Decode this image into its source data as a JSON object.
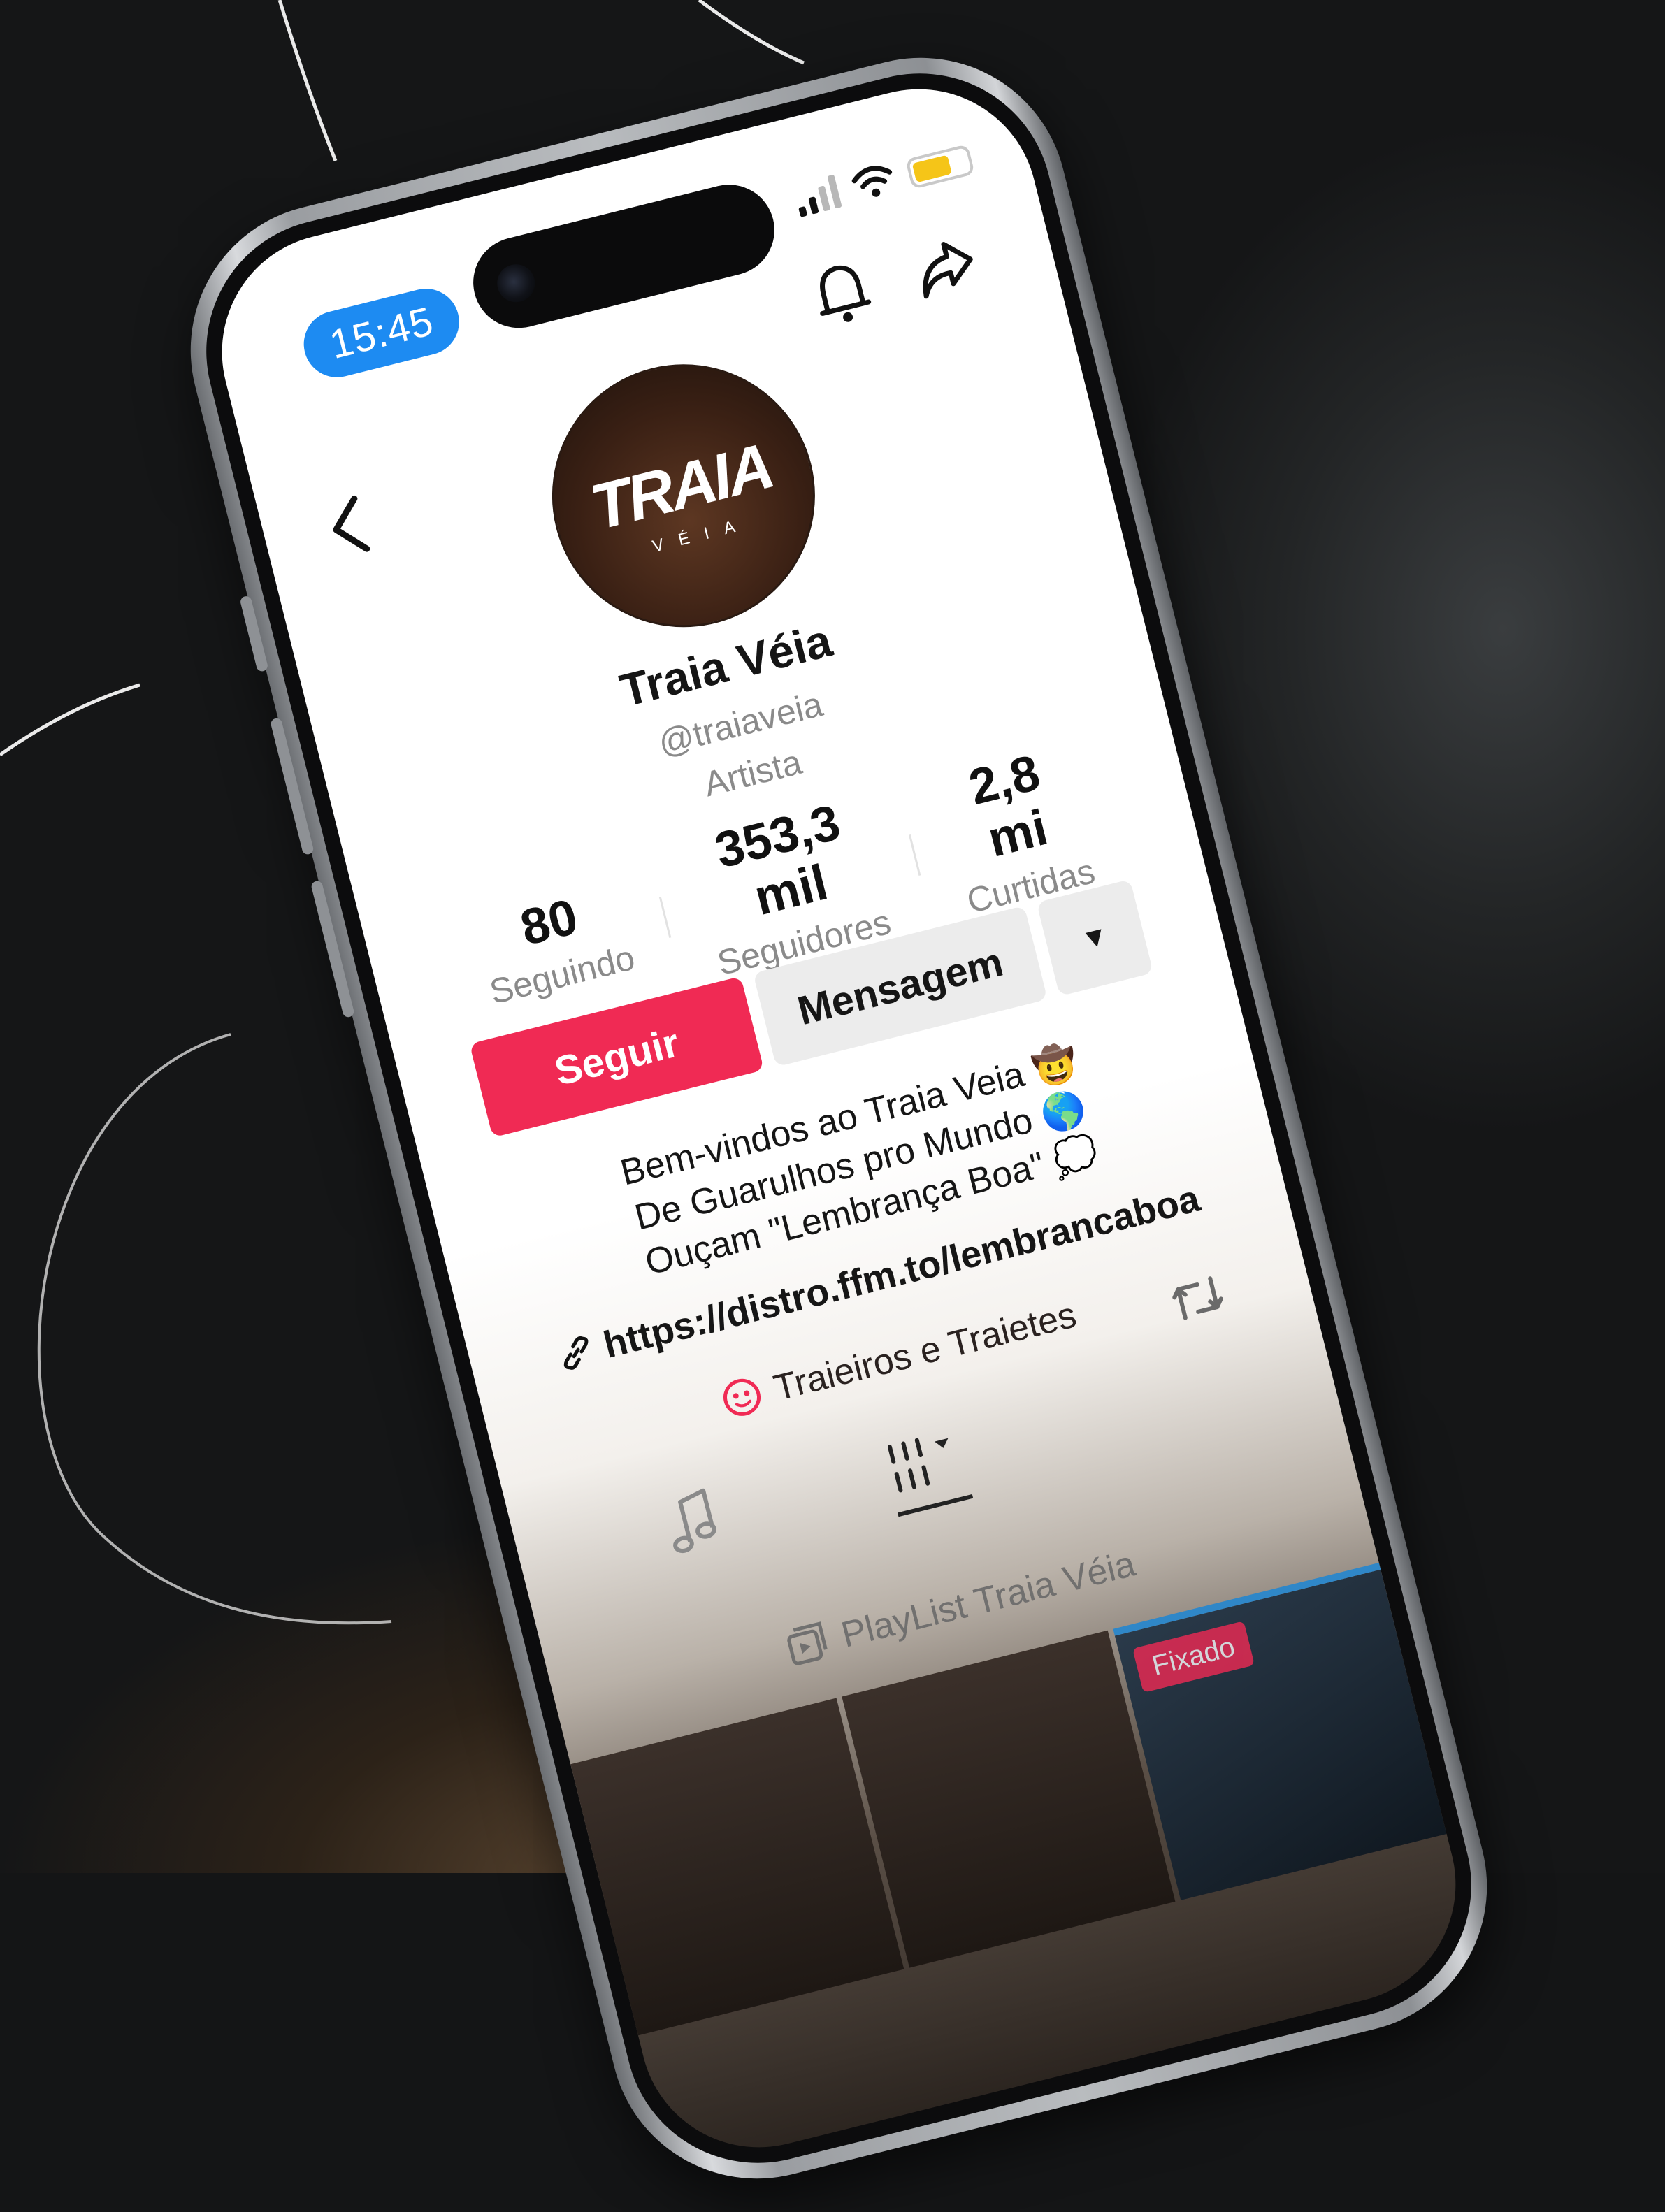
{
  "status_bar": {
    "time": "15:45"
  },
  "profile": {
    "display_name": "Traia Véia",
    "handle": "@traiaveia",
    "category": "Artista",
    "avatar_logo": "TRAIA",
    "avatar_logo_sub": "VÉIA"
  },
  "stats": [
    {
      "value": "80",
      "label": "Seguindo"
    },
    {
      "value": "353,3 mil",
      "label": "Seguidores"
    },
    {
      "value": "2,8 mi",
      "label": "Curtidas"
    }
  ],
  "actions": {
    "follow_label": "Seguir",
    "message_label": "Mensagem",
    "more_label": "▼"
  },
  "bio": {
    "lines": [
      "Bem-vindos ao Traia Veia 🤠",
      "De Guarulhos pro Mundo 🌎",
      "Ouçam \"Lembrança Boa\" 💭"
    ],
    "link": "https://distro.ffm.to/lembrancaboa",
    "community": "Traieiros e Traietes"
  },
  "tabs": {
    "playlist_label": "PlayList Traia Véia"
  },
  "grid": {
    "pinned_label": "Fixado"
  },
  "icons": {
    "back": "chevron-left-icon",
    "bell": "bell-icon",
    "share": "share-icon",
    "link": "link-icon",
    "community": "community-icon",
    "repost": "repost-icon",
    "music": "music-note-icon",
    "videos": "grid-icon",
    "playlist": "playlist-icon"
  },
  "colors": {
    "accent": "#f02a54",
    "time_pill": "#1d8bf2",
    "battery": "#f5c518"
  }
}
